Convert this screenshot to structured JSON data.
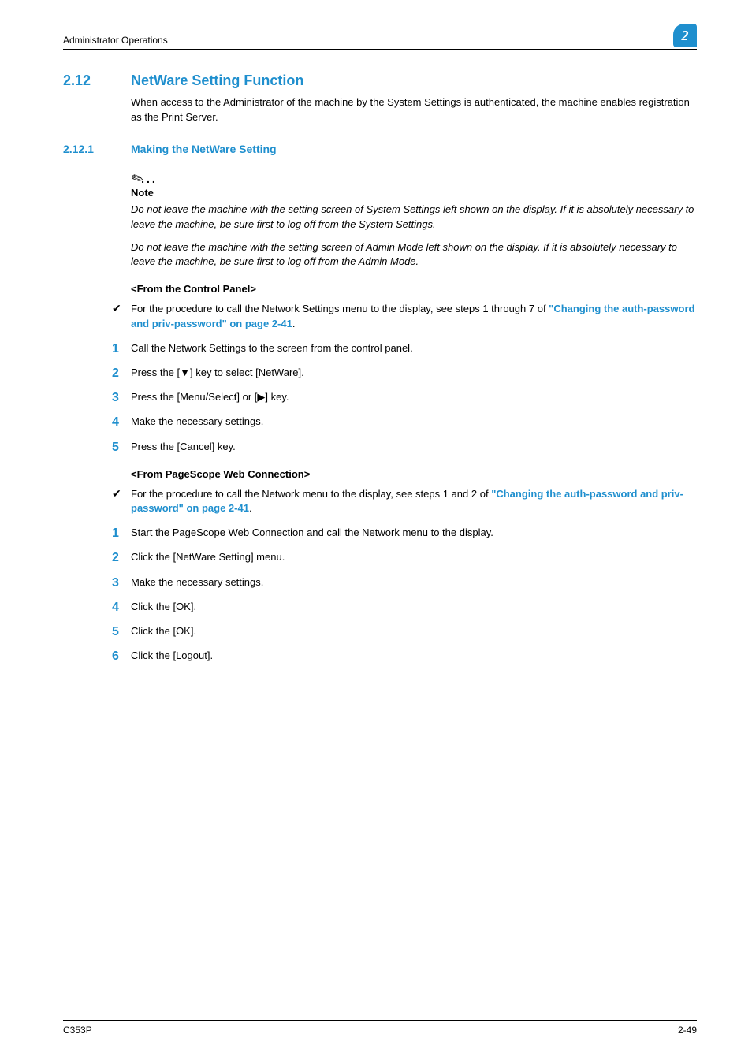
{
  "header": {
    "breadcrumb": "Administrator Operations",
    "badge": "2"
  },
  "section": {
    "num": "2.12",
    "title": "NetWare Setting Function",
    "intro": "When access to the Administrator of the machine by the System Settings is authenticated, the machine enables registration as the Print Server."
  },
  "subsection": {
    "num": "2.12.1",
    "title": "Making the NetWare Setting"
  },
  "note": {
    "heading": "Note",
    "p1": "Do not leave the machine with the setting screen of System Settings left shown on the display. If it is absolutely necessary to leave the machine, be sure first to log off from the System Settings.",
    "p2": "Do not leave the machine with the setting screen of Admin Mode left shown on the display. If it is absolutely necessary to leave the machine, be sure first to log off from the Admin Mode."
  },
  "cp": {
    "heading": "<From the Control Panel>",
    "bullet_pre": "For the procedure to call the Network Settings menu to the display, see steps 1 through 7 of ",
    "bullet_link": "\"Changing the auth-password and priv-password\" on page 2-41",
    "step1": "Call the Network Settings to the screen from the control panel.",
    "step2": "Press the [▼] key to select [NetWare].",
    "step3": "Press the [Menu/Select] or [▶] key.",
    "step4": "Make the necessary settings.",
    "step5": "Press the [Cancel] key."
  },
  "web": {
    "heading": "<From PageScope Web Connection>",
    "bullet_pre": "For the procedure to call the Network menu to the display, see steps 1 and 2 of ",
    "bullet_link": "\"Changing the auth-password and priv-password\" on page 2-41",
    "step1": "Start the PageScope Web Connection and call the Network menu to the display.",
    "step2": "Click the [NetWare Setting] menu.",
    "step3": "Make the necessary settings.",
    "step4": "Click the [OK].",
    "step5": "Click the [OK].",
    "step6": "Click the [Logout]."
  },
  "footer": {
    "left": "C353P",
    "right": "2-49"
  },
  "nums": {
    "n1": "1",
    "n2": "2",
    "n3": "3",
    "n4": "4",
    "n5": "5",
    "n6": "6"
  },
  "period": "."
}
